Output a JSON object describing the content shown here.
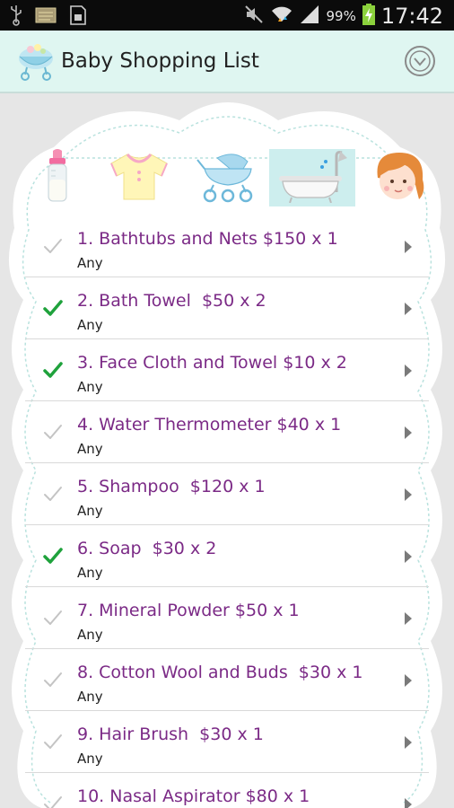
{
  "status_bar": {
    "icons": [
      "usb-icon",
      "sd-card-icon",
      "screenshot-icon",
      "mute-icon",
      "wifi-icon",
      "signal-icon",
      "battery-charging-icon"
    ],
    "battery": "99%",
    "time": "17:42"
  },
  "app": {
    "title": "Baby Shopping List",
    "icon": "baby-carriage-icon",
    "menu_icon": "dropdown-circle-icon"
  },
  "categories": [
    {
      "name": "feeding",
      "icon": "baby-bottle-icon",
      "selected": false
    },
    {
      "name": "clothing",
      "icon": "baby-shirt-icon",
      "selected": false
    },
    {
      "name": "travel",
      "icon": "stroller-icon",
      "selected": false
    },
    {
      "name": "bathing",
      "icon": "bathtub-icon",
      "selected": true
    },
    {
      "name": "baby",
      "icon": "baby-face-icon",
      "selected": false
    }
  ],
  "items": [
    {
      "title": "1. Bathtubs and Nets $150 x 1",
      "sub": "Any",
      "checked": false
    },
    {
      "title": "2. Bath Towel  $50 x 2",
      "sub": "Any",
      "checked": true
    },
    {
      "title": "3. Face Cloth and Towel $10 x 2",
      "sub": "Any",
      "checked": true
    },
    {
      "title": "4. Water Thermometer $40 x 1",
      "sub": "Any",
      "checked": false
    },
    {
      "title": "5. Shampoo  $120 x 1",
      "sub": "Any",
      "checked": false
    },
    {
      "title": "6. Soap  $30 x 2",
      "sub": "Any",
      "checked": true
    },
    {
      "title": "7. Mineral Powder $50 x 1",
      "sub": "Any",
      "checked": false
    },
    {
      "title": "8. Cotton Wool and Buds  $30 x 1",
      "sub": "Any",
      "checked": false
    },
    {
      "title": "9. Hair Brush  $30 x 1",
      "sub": "Any",
      "checked": false
    },
    {
      "title": "10. Nasal Aspirator $80 x 1",
      "sub": "",
      "checked": false
    }
  ],
  "colors": {
    "title_purple": "#7b2a86",
    "check_green": "#1fa23c",
    "check_grey": "#c4c4c4",
    "actionbar_bg": "#dff6f1",
    "selected_bg": "#cdeeee"
  }
}
